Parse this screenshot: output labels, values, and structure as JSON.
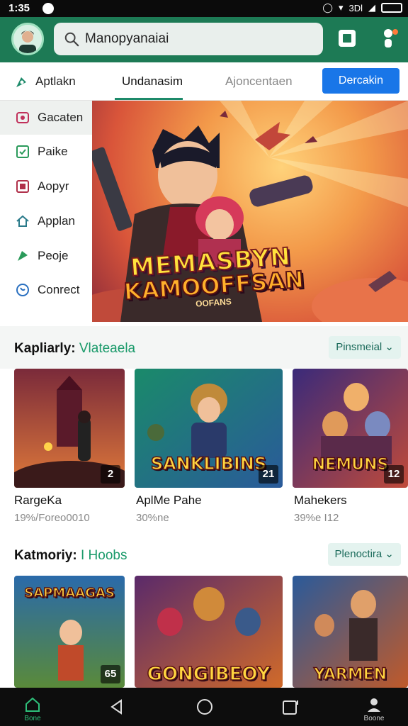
{
  "status_bar": {
    "time": "1:35",
    "signal_text": "3Dl"
  },
  "header": {
    "search": {
      "value": "Manopyanaiai",
      "placeholder": "Manopyanaiai"
    }
  },
  "tabs": {
    "tab1": "Aptlakn",
    "tab2": "Undanasim",
    "tab3": "Ajoncentaen",
    "cta": "Dercakin"
  },
  "sidebar": {
    "items": [
      {
        "label": "Gacaten",
        "icon": "gamepad-icon"
      },
      {
        "label": "Paike",
        "icon": "checkbox-icon"
      },
      {
        "label": "Aopyr",
        "icon": "app-box-icon"
      },
      {
        "label": "Applan",
        "icon": "home-icon"
      },
      {
        "label": "Peoje",
        "icon": "tag-icon"
      },
      {
        "label": "Conrect",
        "icon": "globe-icon"
      }
    ]
  },
  "hero": {
    "title_line1": "MEMASBYN",
    "title_line2": "KAMOOFFSAN",
    "subtitle": "OOFANS"
  },
  "section1": {
    "title": "Kapliarly:",
    "accent": "Vlateaela",
    "dropdown": "Pinsmeial",
    "cards": [
      {
        "name": "RargeKa",
        "sub": "19%/Foreo0010",
        "badge": "2",
        "art_text": ""
      },
      {
        "name": "AplMe Pahe",
        "sub": "30%ne",
        "badge": "21",
        "art_text": "SANKLIBINS"
      },
      {
        "name": "Mahekers",
        "sub": "39%e   I12",
        "badge": "12",
        "art_text": "NEMUNS"
      }
    ]
  },
  "section2": {
    "title": "Katmoriy:",
    "accent": "I Hoobs",
    "dropdown": "Plenoctira",
    "cards": [
      {
        "badge": "65",
        "art_text": "SAPMAAGAS"
      },
      {
        "badge": "",
        "art_text": "GONGIBEOY"
      },
      {
        "badge": "",
        "art_text": "YARMEN"
      }
    ]
  },
  "nav": {
    "home_label": "Bone",
    "profile_label": "Boone"
  },
  "colors": {
    "header_green": "#1d7a55",
    "accent_green": "#1a9a6a",
    "cta_blue": "#1976e8"
  }
}
